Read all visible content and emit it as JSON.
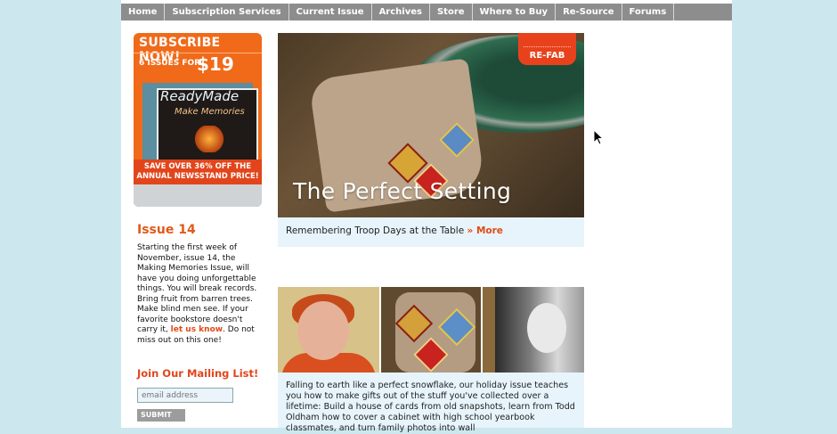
{
  "nav": [
    "Home",
    "Subscription Services",
    "Current Issue",
    "Archives",
    "Store",
    "Where to Buy",
    "Re-Source",
    "Forums"
  ],
  "promo": {
    "headline": "SUBSCRIBE NOW!",
    "issues": "6 ISSUES FOR",
    "price": "$19",
    "magazine_title": "ReadyMade",
    "cover_line": "Make Memories",
    "save_text": "SAVE OVER 36% OFF THE ANNUAL NEWSSTAND PRICE!"
  },
  "issue": {
    "title": "Issue 14",
    "body_before": "Starting the first week of November, issue 14, the Making Memories Issue, will have you doing unforgettable things. You will break records. Bring fruit from barren trees. Make blind men see. If your favorite bookstore doesn't carry it, ",
    "link": "let us know",
    "body_after": ". Do not miss out on this one!"
  },
  "mailing": {
    "title": "Join Our Mailing List!",
    "placeholder": "email address",
    "submit": "SUBMIT"
  },
  "feature": {
    "badge": "RE-FAB",
    "title": "The Perfect Setting",
    "caption": "Remembering Troop Days at the Table",
    "more": "» More"
  },
  "blurb": "Falling to earth like a perfect snowflake, our holiday issue teaches you how to make gifts out of the stuff you've collected over a lifetime: Build a house of cards from old snapshots, learn from Todd Oldham how to cover a cabinet with high school yearbook classmates, and turn family photos into wall"
}
